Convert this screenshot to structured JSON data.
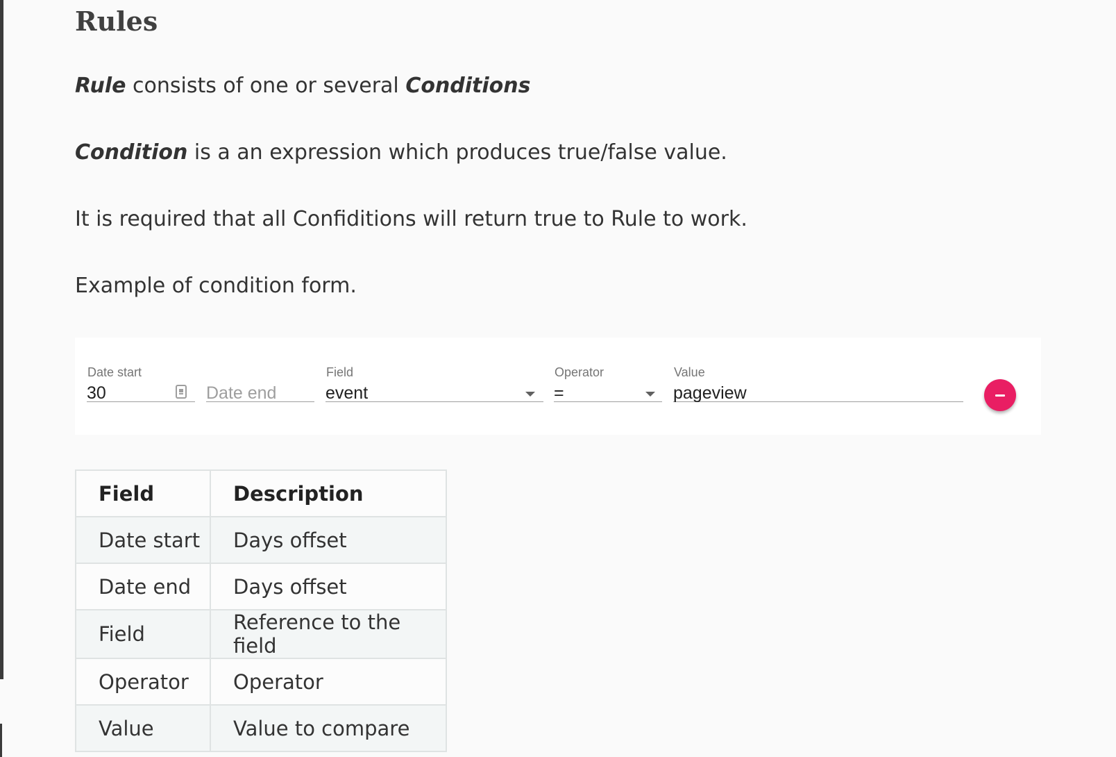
{
  "heading": "Rules",
  "paragraphs": {
    "p1": {
      "em1": "Rule",
      "mid": " consists of one or several ",
      "em2": "Conditions"
    },
    "p2": {
      "em1": "Condition",
      "rest": " is a an expression which produces true/false value."
    },
    "p3": "It is required that all Confiditions will return true to Rule to work.",
    "p4": "Example of condition form."
  },
  "form": {
    "date_start": {
      "label": "Date start",
      "value": "30"
    },
    "date_end": {
      "placeholder": "Date end"
    },
    "field": {
      "label": "Field",
      "value": "event"
    },
    "operator": {
      "label": "Operator",
      "value": "="
    },
    "value": {
      "label": "Value",
      "value": "pageview"
    },
    "accent_color": "#e91e63"
  },
  "table": {
    "headers": [
      "Field",
      "Description"
    ],
    "rows": [
      [
        "Date start",
        "Days offset"
      ],
      [
        "Date end",
        "Days offset"
      ],
      [
        "Field",
        "Reference to the field"
      ],
      [
        "Operator",
        "Operator"
      ],
      [
        "Value",
        "Value to compare"
      ]
    ]
  }
}
